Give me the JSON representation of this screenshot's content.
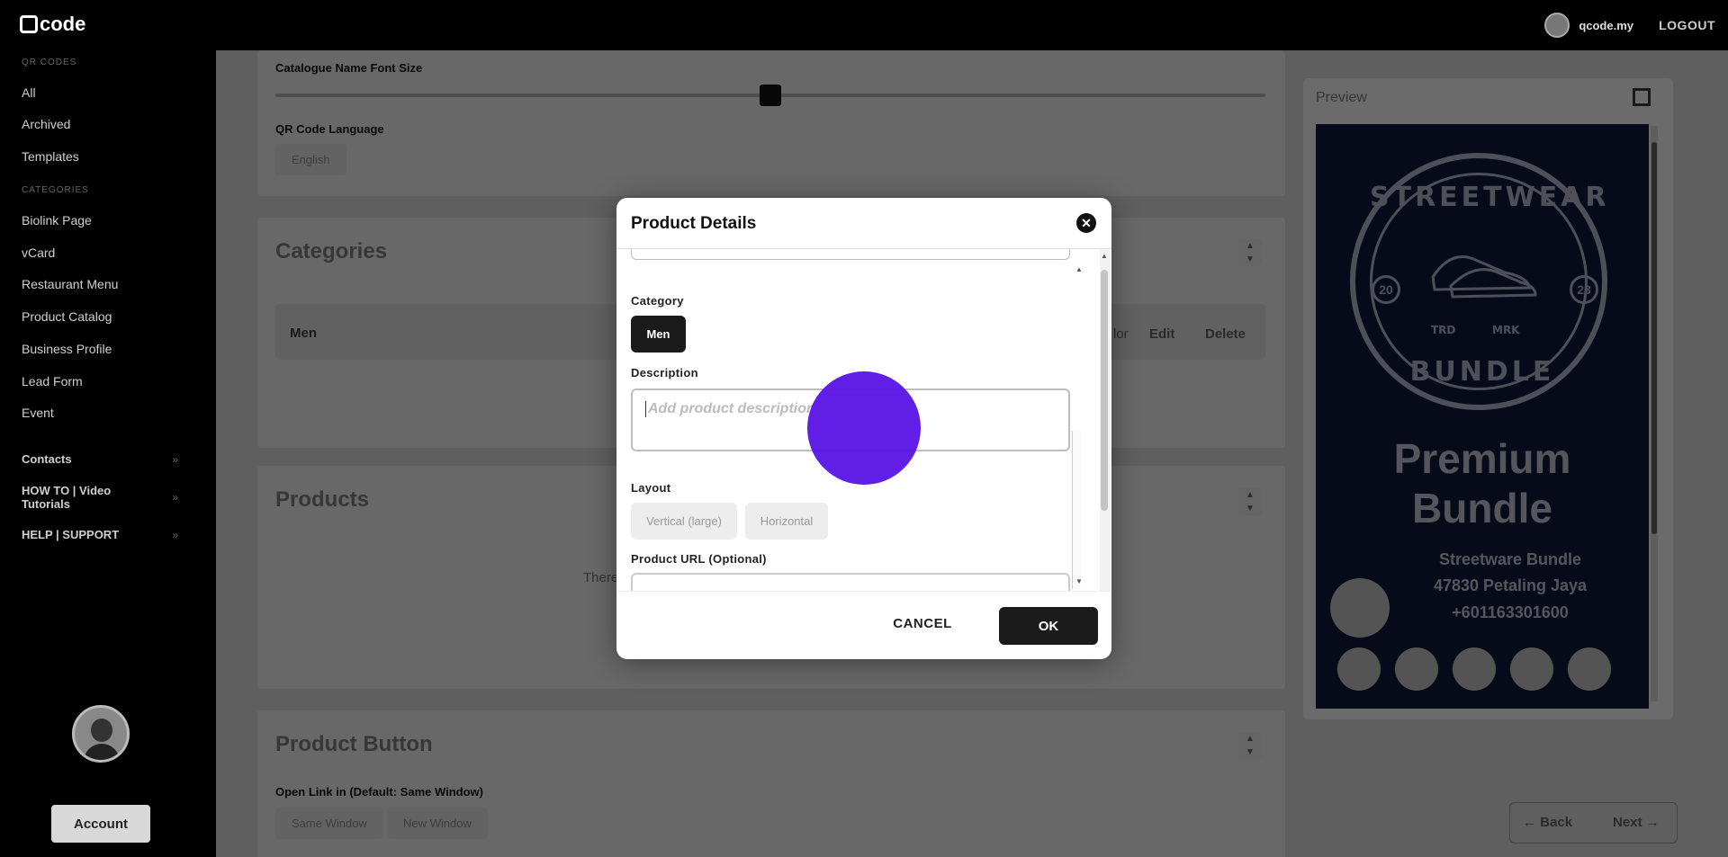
{
  "app": {
    "logo": "code",
    "user": "qcode.my",
    "logout": "LOGOUT"
  },
  "sidebar": {
    "qr_section": "QR CODES",
    "qr_items": [
      "All",
      "Archived",
      "Templates"
    ],
    "cat_section": "CATEGORIES",
    "cat_items": [
      "Biolink Page",
      "vCard",
      "Restaurant Menu",
      "Product Catalog",
      "Business Profile",
      "Lead Form",
      "Event"
    ],
    "groups": [
      "Contacts",
      "HOW TO | Video Tutorials",
      "HELP | SUPPORT"
    ],
    "account": "Account"
  },
  "main": {
    "font_size_label": "Catalogue Name Font Size",
    "font_size_slider_position": 0.5,
    "language_label": "QR Code Language",
    "language_value": "English",
    "categories_title": "Categories",
    "category_row": {
      "name": "Men",
      "partial": "lor",
      "edit": "Edit",
      "delete": "Delete"
    },
    "products_title": "Products",
    "products_hint": "There",
    "product_button_title": "Product Button",
    "open_link_label": "Open Link in (Default: Same Window)",
    "open_link_options": [
      "Same Window",
      "New Window"
    ]
  },
  "preview": {
    "title": "Preview",
    "badge_top": "STREETWEAR",
    "badge_bottom": "BUNDLE",
    "badge_years": [
      "20",
      "23"
    ],
    "badge_marks": [
      "TRD",
      "MRK"
    ],
    "heading": [
      "Premium",
      "Bundle"
    ],
    "lines": [
      "Streetware Bundle",
      "47830 Petaling Jaya",
      "+601163301600"
    ]
  },
  "nav": {
    "back": "Back",
    "next": "Next"
  },
  "modal": {
    "title": "Product Details",
    "category_label": "Category",
    "category_chip": "Men",
    "description_label": "Description",
    "description_placeholder": "Add product description",
    "layout_label": "Layout",
    "layout_options": [
      "Vertical (large)",
      "Horizontal"
    ],
    "url_label": "Product URL (Optional)",
    "cancel": "CANCEL",
    "ok": "OK"
  }
}
